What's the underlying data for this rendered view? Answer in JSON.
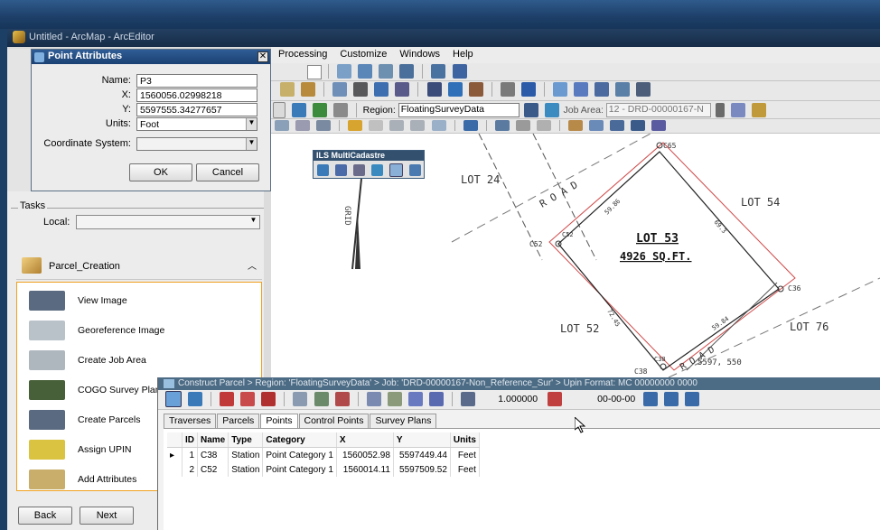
{
  "window": {
    "title": "Untitled - ArcMap - ArcEditor"
  },
  "menubar": {
    "items": [
      "Processing",
      "Customize",
      "Windows",
      "Help"
    ]
  },
  "toolbar": {
    "region_label": "Region:",
    "region_value": "FloatingSurveyData",
    "job_area_label": "Job Area:",
    "job_area_value": "12 - DRD-00000167-N"
  },
  "floating_toolbar": {
    "title": "ILS MultiCadastre"
  },
  "point_attributes": {
    "title": "Point Attributes",
    "name_label": "Name:",
    "name_value": "P3",
    "x_label": "X:",
    "x_value": "1560056.02998218",
    "y_label": "Y:",
    "y_value": "5597555.34277657",
    "units_label": "Units:",
    "units_value": "Foot",
    "cs_label": "Coordinate System:",
    "cs_value": "",
    "ok_label": "OK",
    "cancel_label": "Cancel"
  },
  "left_panel": {
    "tasks_label": "Tasks",
    "local_label": "Local:",
    "local_value": "",
    "group_title": "Parcel_Creation",
    "items": [
      {
        "label": "View Image",
        "color": "#5a6a80"
      },
      {
        "label": "Georeference Image",
        "color": "#b9c2c9"
      },
      {
        "label": "Create Job Area",
        "color": "#aeb7be"
      },
      {
        "label": "COGO Survey Plan",
        "color": "#48603a"
      },
      {
        "label": "Create Parcels",
        "color": "#5a6a80"
      },
      {
        "label": "Assign UPIN",
        "color": "#d9c340"
      },
      {
        "label": "Add Attributes",
        "color": "#c8ae6a"
      }
    ],
    "back_label": "Back",
    "next_label": "Next"
  },
  "map": {
    "labels": {
      "road": "R O A D",
      "lot24": "LOT 24",
      "lot54": "LOT 54",
      "lot53": "LOT 53",
      "area": "4926 SQ.FT.",
      "lot52": "LOT 52",
      "lot76": "LOT 76",
      "c65": "C65",
      "c52a": "C52",
      "c52b": "C52",
      "c36": "C36",
      "c38a": "C38",
      "c38b": "C38",
      "dist1": "59.86",
      "dist2": "69.3",
      "dist3": "72.45",
      "dist4": "59.84",
      "road2": "R O A D",
      "grid": "GRID",
      "coord": "5597, 550"
    }
  },
  "construct_parcel": {
    "title": "Construct Parcel > Region: 'FloatingSurveyData' > Job: 'DRD-00000167-Non_Reference_Sur' > Upin Format: MC 00000000 0000",
    "scale_value": "1.000000",
    "angle_value": "00-00-00",
    "tabs": [
      "Traverses",
      "Parcels",
      "Points",
      "Control Points",
      "Survey Plans"
    ],
    "active_tab": "Points",
    "columns": [
      "ID",
      "Name",
      "Type",
      "Category",
      "X",
      "Y",
      "Units"
    ],
    "rows": [
      {
        "id": "1",
        "name": "C38",
        "type": "Station",
        "category": "Point Category 1",
        "x": "1560052.98",
        "y": "5597449.44",
        "units": "Feet"
      },
      {
        "id": "2",
        "name": "C52",
        "type": "Station",
        "category": "Point Category 1",
        "x": "1560014.11",
        "y": "5597509.52",
        "units": "Feet"
      }
    ]
  }
}
